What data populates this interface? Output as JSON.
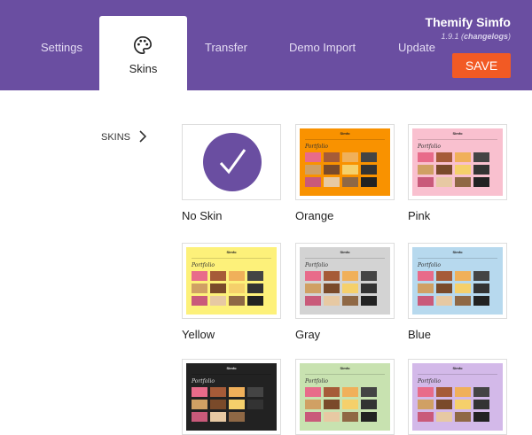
{
  "header": {
    "tabs": [
      {
        "label": "Settings"
      },
      {
        "label": "Skins"
      },
      {
        "label": "Transfer"
      },
      {
        "label": "Demo Import"
      },
      {
        "label": "Update"
      }
    ],
    "brand": "Themify Simfo",
    "version_number": "1.9.1",
    "version_link": "changelogs",
    "save_label": "SAVE"
  },
  "sidebar": {
    "label": "SKINS"
  },
  "skins": [
    {
      "name": "No Skin",
      "bg": "#ffffff",
      "selected": true
    },
    {
      "name": "Orange",
      "bg": "#f99200"
    },
    {
      "name": "Pink",
      "bg": "#f9c0cf"
    },
    {
      "name": "Yellow",
      "bg": "#fdf17a"
    },
    {
      "name": "Gray",
      "bg": "#d3d3d3"
    },
    {
      "name": "Blue",
      "bg": "#b7d9ee"
    },
    {
      "name": "",
      "bg": "#222222"
    },
    {
      "name": "",
      "bg": "#c8e2b0"
    },
    {
      "name": "",
      "bg": "#d3b9e9"
    }
  ],
  "preview": {
    "title": "Simfo",
    "heading": "Portfolio"
  },
  "colors": {
    "header_bg": "#6a4ea1",
    "save_bg": "#f25a24"
  }
}
